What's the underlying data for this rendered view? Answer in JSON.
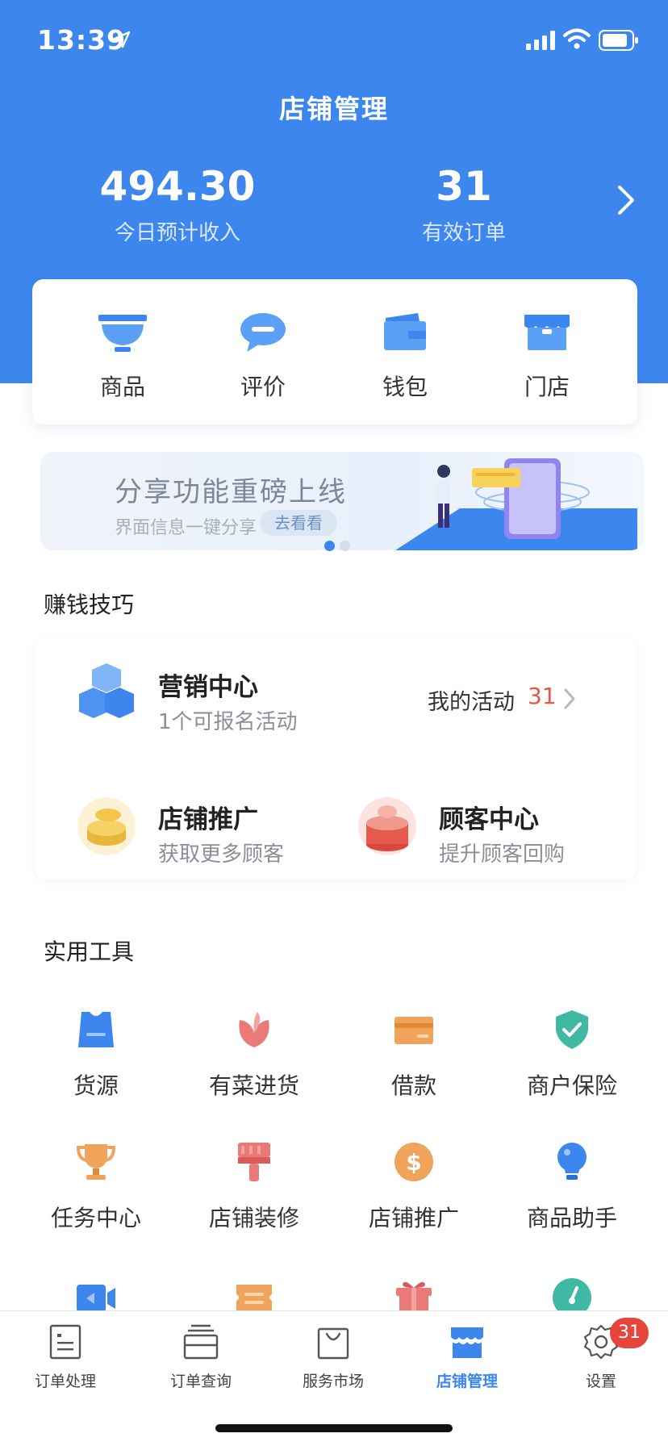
{
  "status_bar": {
    "time": "13:39"
  },
  "header": {
    "title": "店铺管理",
    "income_value": "494.30",
    "income_label": "今日预计收入",
    "orders_value": "31",
    "orders_label": "有效订单"
  },
  "quick_actions": [
    {
      "label": "商品",
      "icon": "bowl-icon"
    },
    {
      "label": "评价",
      "icon": "speech-bubble-icon"
    },
    {
      "label": "钱包",
      "icon": "wallet-icon"
    },
    {
      "label": "门店",
      "icon": "store-icon"
    }
  ],
  "banner": {
    "title": "分享功能重磅上线",
    "subtitle": "界面信息一键分享",
    "button": "去看看",
    "page_count": 2,
    "active_page": 1
  },
  "earn": {
    "section_title": "赚钱技巧",
    "marketing": {
      "title": "营销中心",
      "subtitle": "1个可报名活动",
      "link_label": "我的活动",
      "link_count": "31"
    },
    "promotion": {
      "title": "店铺推广",
      "subtitle": "获取更多顾客"
    },
    "customers": {
      "title": "顾客中心",
      "subtitle": "提升顾客回购"
    }
  },
  "tools": {
    "section_title": "实用工具",
    "items": [
      {
        "label": "货源",
        "icon": "vest-icon"
      },
      {
        "label": "有菜进货",
        "icon": "leaf-icon"
      },
      {
        "label": "借款",
        "icon": "card-icon"
      },
      {
        "label": "商户保险",
        "icon": "shield-check-icon"
      },
      {
        "label": "任务中心",
        "icon": "trophy-icon"
      },
      {
        "label": "店铺装修",
        "icon": "paint-brush-icon"
      },
      {
        "label": "店铺推广",
        "icon": "dollar-coin-icon"
      },
      {
        "label": "商品助手",
        "icon": "lightbulb-icon"
      }
    ],
    "partial_icons": [
      "video-icon",
      "ticket-icon",
      "gift-icon",
      "gauge-icon"
    ]
  },
  "tab_bar": {
    "items": [
      {
        "label": "订单处理",
        "icon": "order-list-icon"
      },
      {
        "label": "订单查询",
        "icon": "stack-icon"
      },
      {
        "label": "服务市场",
        "icon": "shopping-bag-icon"
      },
      {
        "label": "店铺管理",
        "icon": "shop-icon",
        "active": true
      },
      {
        "label": "设置",
        "icon": "gear-icon",
        "badge": "31"
      }
    ]
  },
  "colors": {
    "brand_blue": "#3c86ee",
    "badge_red": "#e5453a",
    "count_red": "#e05a4a"
  }
}
